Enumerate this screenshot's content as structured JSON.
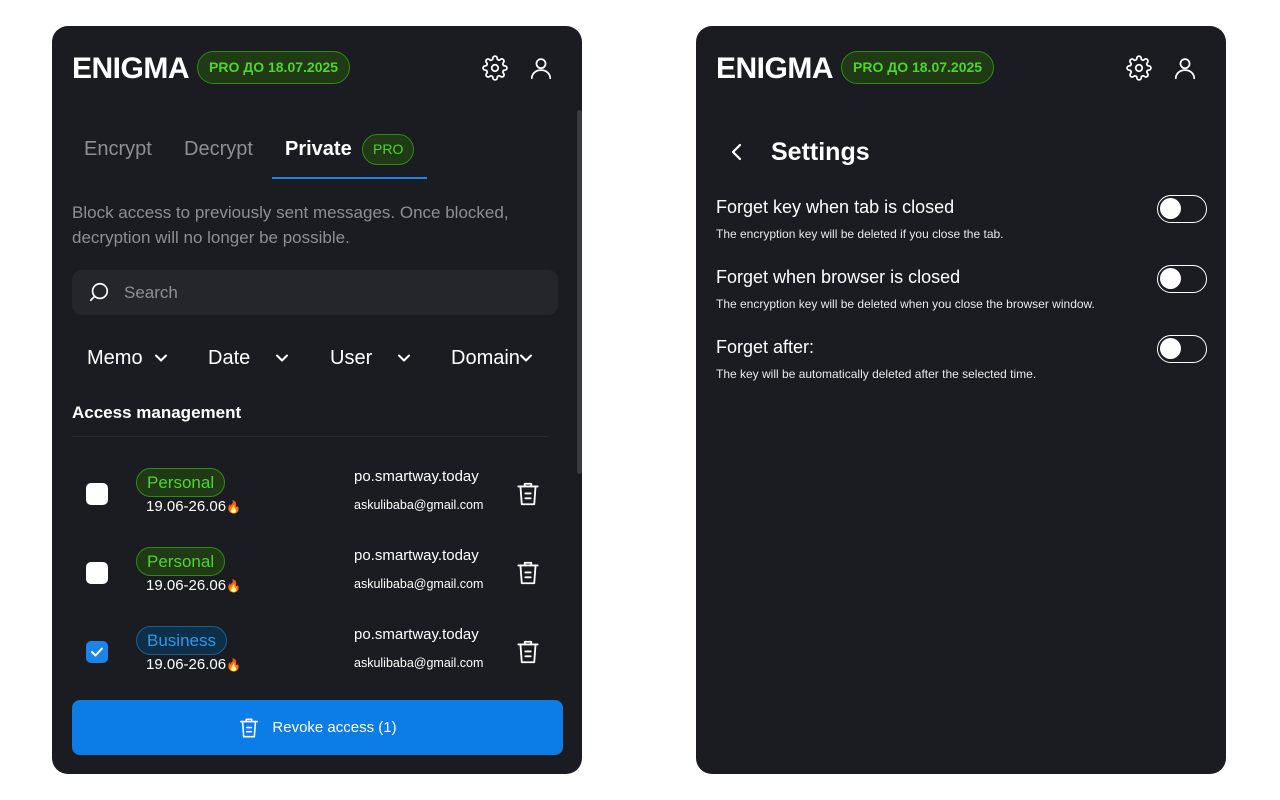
{
  "brand": {
    "logo": "ENIGMA",
    "pro_badge": "PRO ДО 18.07.2025"
  },
  "tabs": [
    {
      "label": "Encrypt"
    },
    {
      "label": "Decrypt"
    },
    {
      "label": "Private",
      "badge": "PRO",
      "active": true
    }
  ],
  "private_view": {
    "description": "Block access to previously sent messages. Once blocked, decryption will no longer be possible.",
    "search": {
      "placeholder": "Search",
      "value": ""
    },
    "filters": [
      {
        "label": "Memo"
      },
      {
        "label": "Date"
      },
      {
        "label": "User"
      },
      {
        "label": "Domain"
      }
    ],
    "section_title": "Access management",
    "rows": [
      {
        "checked": false,
        "tag": "Personal",
        "tag_kind": "personal",
        "dates": "19.06-26.06",
        "flame": "🔥",
        "domain": "po.smartway.today",
        "email": "askulibaba@gmail.com"
      },
      {
        "checked": false,
        "tag": "Personal",
        "tag_kind": "personal",
        "dates": "19.06-26.06",
        "flame": "🔥",
        "domain": "po.smartway.today",
        "email": "askulibaba@gmail.com"
      },
      {
        "checked": true,
        "tag": "Business",
        "tag_kind": "business",
        "dates": "19.06-26.06",
        "flame": "🔥",
        "domain": "po.smartway.today",
        "email": "askulibaba@gmail.com"
      }
    ],
    "revoke_button": "Revoke access (1)"
  },
  "settings_view": {
    "title": "Settings",
    "items": [
      {
        "title": "Forget key when tab is closed",
        "description": "The encryption key will be deleted if you close the tab.",
        "enabled": false
      },
      {
        "title": "Forget when browser is closed",
        "description": "The encryption key will be deleted when you close the browser window.",
        "enabled": false
      },
      {
        "title": "Forget after:",
        "description": "The key will be automatically deleted after the selected time.",
        "enabled": false
      }
    ]
  },
  "colors": {
    "panel_bg": "#1b1c21",
    "accent_blue": "#0c7ce6",
    "pro_green": "#52d42a",
    "business_blue": "#2f98ec",
    "muted_text": "#8e8f94"
  },
  "icons": {
    "settings": "gear-icon",
    "profile": "user-icon",
    "search": "search-icon",
    "dropdown": "chevron-down-icon",
    "delete": "trash-icon",
    "back": "chevron-left-icon",
    "check": "check-icon"
  }
}
